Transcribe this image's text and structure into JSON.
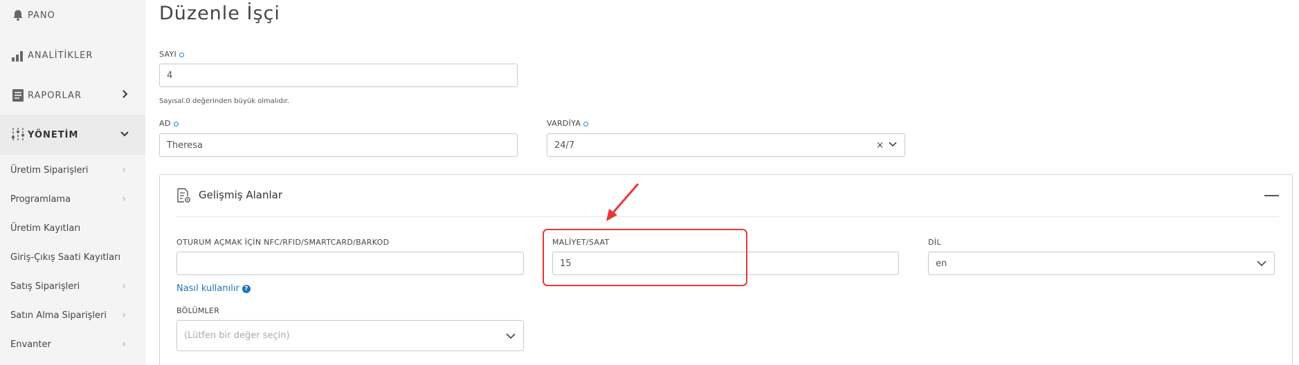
{
  "sidebar": {
    "top_items": [
      {
        "label": "PANO",
        "icon": "bell-icon"
      },
      {
        "label": "ANALİTİKLER",
        "icon": "bar-chart-icon"
      },
      {
        "label": "RAPORLAR",
        "icon": "report-icon"
      },
      {
        "label": "YÖNETİM",
        "icon": "sliders-icon"
      }
    ],
    "sub_items": [
      {
        "label": "Üretim Siparişleri"
      },
      {
        "label": "Programlama"
      },
      {
        "label": "Üretim Kayıtları"
      },
      {
        "label": "Giriş-Çıkış Saati Kayıtları"
      },
      {
        "label": "Satış Siparişleri"
      },
      {
        "label": "Satın Alma Siparişleri"
      },
      {
        "label": "Envanter"
      }
    ]
  },
  "page": {
    "title": "Düzenle İşçi"
  },
  "form": {
    "number": {
      "label": "SAYI",
      "value": "4",
      "helper": "Sayısal.0 değerinden büyük olmalıdır."
    },
    "name": {
      "label": "AD",
      "value": "Theresa"
    },
    "shift": {
      "label": "VARDİYA",
      "value": "24/7",
      "clear": "×"
    }
  },
  "advanced": {
    "title": "Gelişmiş Alanlar",
    "nfc": {
      "label": "OTURUM AÇMAK İÇİN NFC/RFID/SMARTCARD/BARKOD",
      "value": ""
    },
    "howto_link": "Nasıl kullanılır",
    "help_glyph": "?",
    "cost": {
      "label": "MALİYET/SAAT",
      "value": "15"
    },
    "language": {
      "label": "DİL",
      "value": "en"
    },
    "departments": {
      "label": "BÖLÜMLER",
      "placeholder": "(Lütfen bir değer seçin)"
    }
  },
  "colors": {
    "accent": "#1e73be",
    "required_dot": "#1e88c7",
    "annotation": "#e53935"
  }
}
